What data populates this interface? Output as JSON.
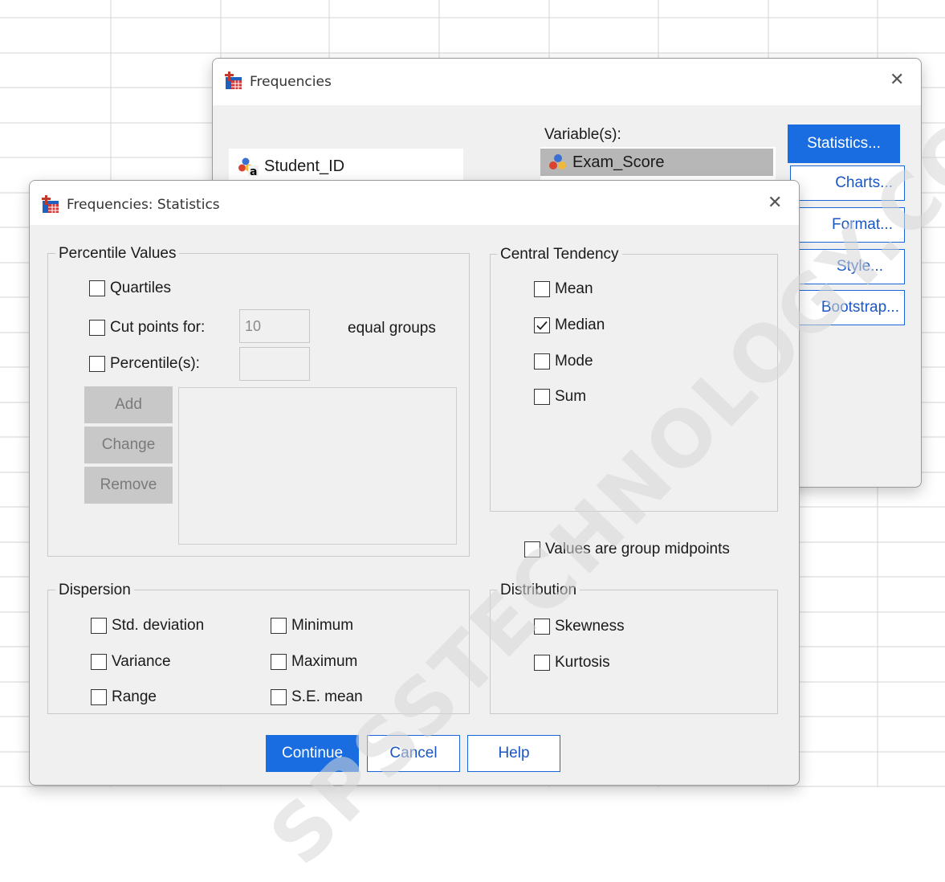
{
  "main_dialog": {
    "title": "Frequencies",
    "variables_label": "Variable(s):",
    "source_variables": [
      {
        "name": "Student_ID",
        "icon": "nominal-string-variable-icon"
      }
    ],
    "selected_variables": [
      {
        "name": "Exam_Score",
        "icon": "nominal-variable-icon"
      }
    ],
    "buttons": {
      "statistics": "Statistics...",
      "charts": "Charts...",
      "format": "Format...",
      "style": "Style...",
      "bootstrap": "Bootstrap..."
    }
  },
  "stats_dialog": {
    "title": "Frequencies: Statistics",
    "percentile_values": {
      "legend": "Percentile Values",
      "quartiles": {
        "label": "Quartiles",
        "checked": false
      },
      "cut_points": {
        "label": "Cut points for:",
        "checked": false,
        "value": "10",
        "suffix": "equal groups"
      },
      "percentiles": {
        "label": "Percentile(s):",
        "checked": false,
        "value": ""
      },
      "add": "Add",
      "change": "Change",
      "remove": "Remove"
    },
    "central_tendency": {
      "legend": "Central Tendency",
      "items": [
        {
          "label": "Mean",
          "checked": false
        },
        {
          "label": "Median",
          "checked": true
        },
        {
          "label": "Mode",
          "checked": false
        },
        {
          "label": "Sum",
          "checked": false
        }
      ]
    },
    "group_midpoints": {
      "label": "Values are group midpoints",
      "checked": false
    },
    "dispersion": {
      "legend": "Dispersion",
      "std_deviation": {
        "label": "Std. deviation",
        "checked": false
      },
      "variance": {
        "label": "Variance",
        "checked": false
      },
      "range": {
        "label": "Range",
        "checked": false
      },
      "minimum": {
        "label": "Minimum",
        "checked": false
      },
      "maximum": {
        "label": "Maximum",
        "checked": false
      },
      "se_mean": {
        "label": "S.E. mean",
        "checked": false
      }
    },
    "distribution": {
      "legend": "Distribution",
      "skewness": {
        "label": "Skewness",
        "checked": false
      },
      "kurtosis": {
        "label": "Kurtosis",
        "checked": false
      }
    },
    "buttons": {
      "continue": "Continue",
      "cancel": "Cancel",
      "help": "Help"
    }
  },
  "watermark": "SPSSTECHNOLOGY.COM",
  "colors": {
    "accent": "#1a6de0",
    "grid": "#cfcfcf",
    "dialog_bg": "#f0f0f0"
  }
}
